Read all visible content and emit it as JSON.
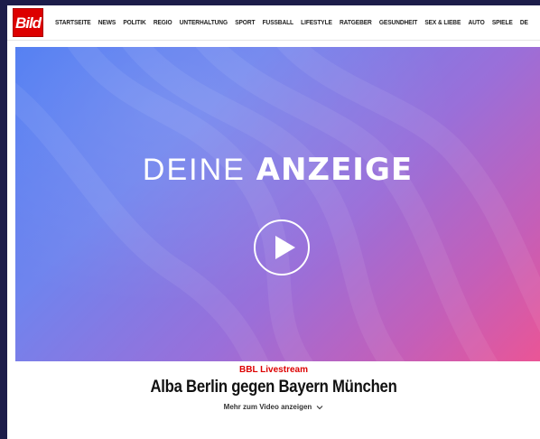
{
  "header": {
    "logo_text": "Bild",
    "logo_color": "#dd0000",
    "nav_items": [
      {
        "label": "STARTSEITE"
      },
      {
        "label": "NEWS"
      },
      {
        "label": "POLITIK"
      },
      {
        "label": "REGIO"
      },
      {
        "label": "UNTERHALTUNG"
      },
      {
        "label": "SPORT"
      },
      {
        "label": "FUSSBALL"
      },
      {
        "label": "LIFESTYLE"
      },
      {
        "label": "RATGEBER"
      },
      {
        "label": "GESUNDHEIT"
      },
      {
        "label": "SEX & LIEBE"
      },
      {
        "label": "AUTO"
      },
      {
        "label": "SPIELE"
      },
      {
        "label": "DE"
      }
    ]
  },
  "video": {
    "ad_title_light": "DEINE",
    "ad_title_bold": "ANZEIGE",
    "play_icon": "play-icon",
    "gradient_start": "#4e7bf2",
    "gradient_end": "#ea5596"
  },
  "article": {
    "kicker": "BBL Livestream",
    "kicker_color": "#dd0000",
    "headline": "Alba Berlin gegen Bayern München",
    "more_label": "Mehr zum Video anzeigen",
    "more_icon": "chevron-down-icon"
  }
}
